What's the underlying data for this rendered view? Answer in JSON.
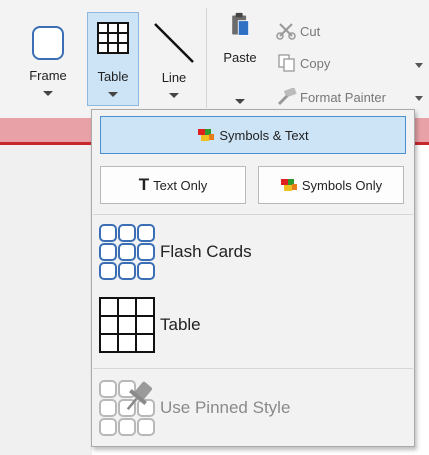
{
  "ribbon": {
    "frame_label": "Frame",
    "table_label": "Table",
    "line_label": "Line",
    "paste_label": "Paste",
    "cut_label": "Cut",
    "copy_label": "Copy",
    "format_painter_label": "Format Painter"
  },
  "dropdown": {
    "symbols_text_label": "Symbols & Text",
    "text_only_label": "Text Only",
    "symbols_only_label": "Symbols Only",
    "flash_cards_label": "Flash Cards",
    "table_label": "Table",
    "pinned_style_label": "Use Pinned Style"
  },
  "icons": {
    "frame": "frame-icon",
    "table": "table-grid-icon",
    "line": "line-icon",
    "paste": "paste-clipboard-icon",
    "cut": "scissors-icon",
    "copy": "copy-icon",
    "format_painter": "brush-icon",
    "symbols": "symbols-icon",
    "text": "text-t-icon",
    "flash_cards": "flash-cards-icon",
    "pin": "pin-icon"
  },
  "colors": {
    "selected_bg": "#cde4f7",
    "selected_border": "#4a8fd0",
    "accent_red": "#c7282e"
  }
}
